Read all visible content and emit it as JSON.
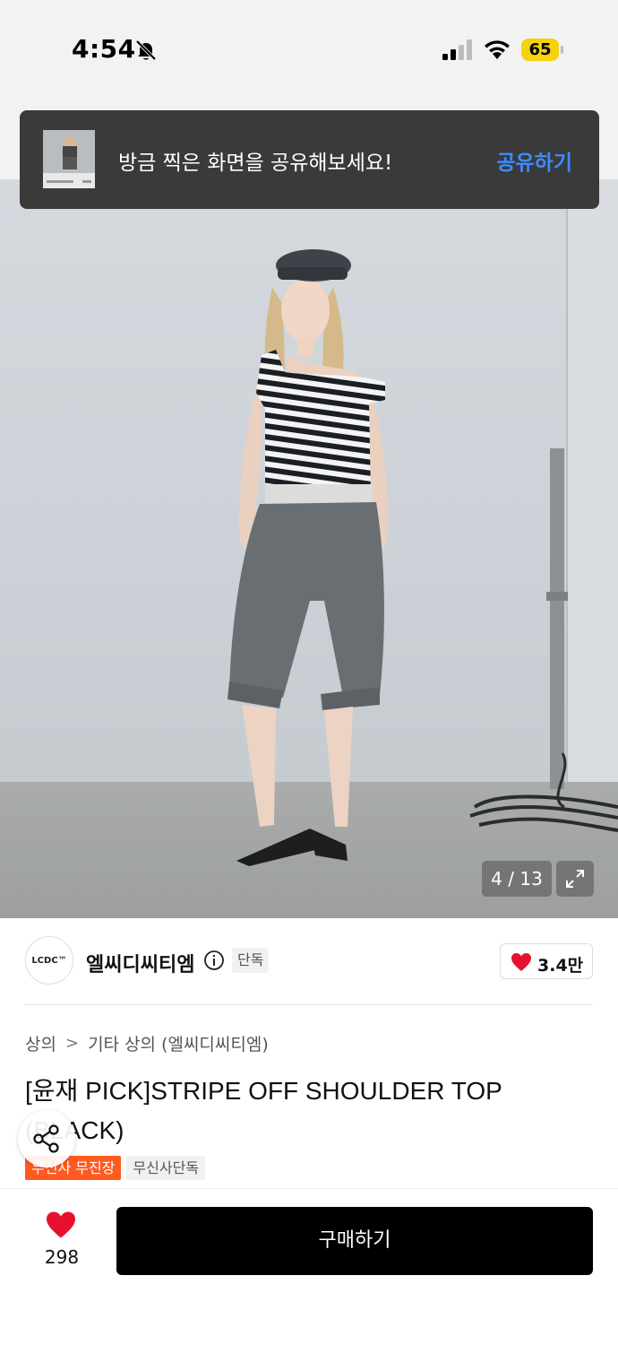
{
  "status_bar": {
    "time": "4:54",
    "battery": "65"
  },
  "share_toast": {
    "message": "방금 찍은 화면을 공유해보세요!",
    "action_label": "공유하기"
  },
  "gallery": {
    "counter": "4 / 13"
  },
  "brand": {
    "logo_text": "LCDC™",
    "name": "엘씨디씨티엠",
    "exclusive_tag": "단독",
    "likes": "3.4만"
  },
  "product": {
    "breadcrumb": [
      "상의",
      "기타 상의 (엘씨디씨티엠)"
    ],
    "breadcrumb_separator": ">",
    "title": "[윤재 PICK]STRIPE OFF SHOULDER TOP (BLACK)",
    "badges": [
      "무신사 무진장",
      "무신사단독"
    ]
  },
  "bottom_bar": {
    "wish_count": "298",
    "buy_label": "구매하기"
  },
  "colors": {
    "accent_blue": "#3d8bff",
    "heart_red": "#e8112d",
    "badge_orange": "#ff5a1f"
  },
  "icons": [
    "bell-muted-icon",
    "signal-icon",
    "wifi-icon",
    "expand-icon",
    "info-icon",
    "heart-icon",
    "share-icon"
  ]
}
